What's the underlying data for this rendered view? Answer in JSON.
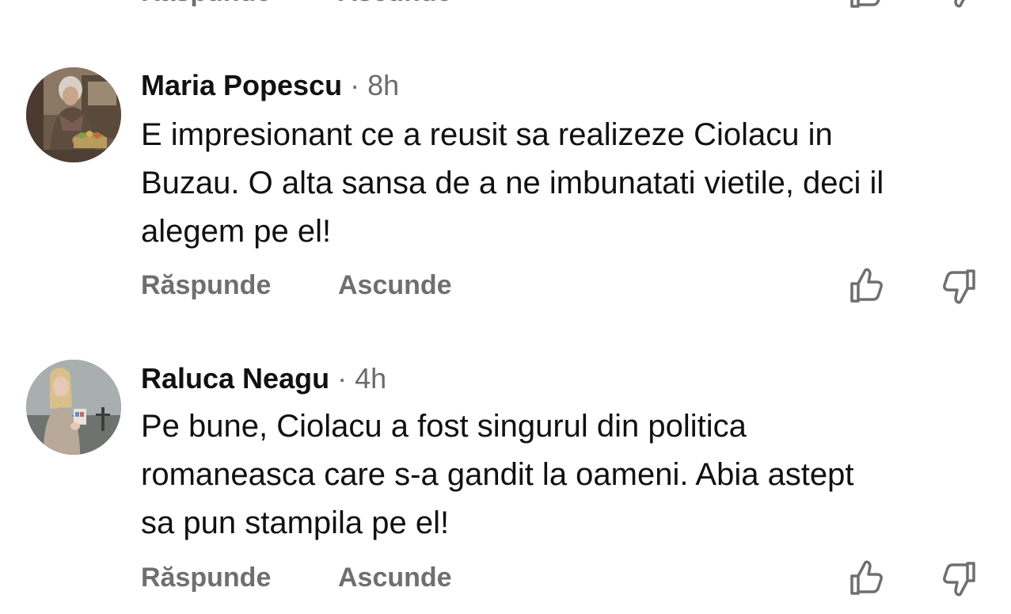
{
  "previous_comment": {
    "reply_label": "Răspunde",
    "hide_label": "Ascunde"
  },
  "comments": [
    {
      "author": "Maria Popescu",
      "separator": "·",
      "time": "8h",
      "lines": [
        "E impresionant ce a reusit sa realizeze Ciolacu in",
        "Buzau. O alta sansa de a ne imbunatati vietile, deci il",
        "alegem pe el!"
      ],
      "reply_label": "Răspunde",
      "hide_label": "Ascunde",
      "like_icon": "thumbs-up-icon",
      "dislike_icon": "thumbs-down-icon"
    },
    {
      "author": "Raluca Neagu",
      "separator": "·",
      "time": "4h",
      "lines": [
        "Pe bune, Ciolacu a fost singurul din politica",
        "romaneasca care s-a gandit la oameni. Abia astept",
        "sa pun stampila pe el!"
      ],
      "reply_label": "Răspunde",
      "hide_label": "Ascunde",
      "like_icon": "thumbs-up-icon",
      "dislike_icon": "thumbs-down-icon"
    }
  ],
  "colors": {
    "text": "#111111",
    "meta": "#6b6b6b",
    "action": "#6f6f6f",
    "background": "#ffffff"
  }
}
